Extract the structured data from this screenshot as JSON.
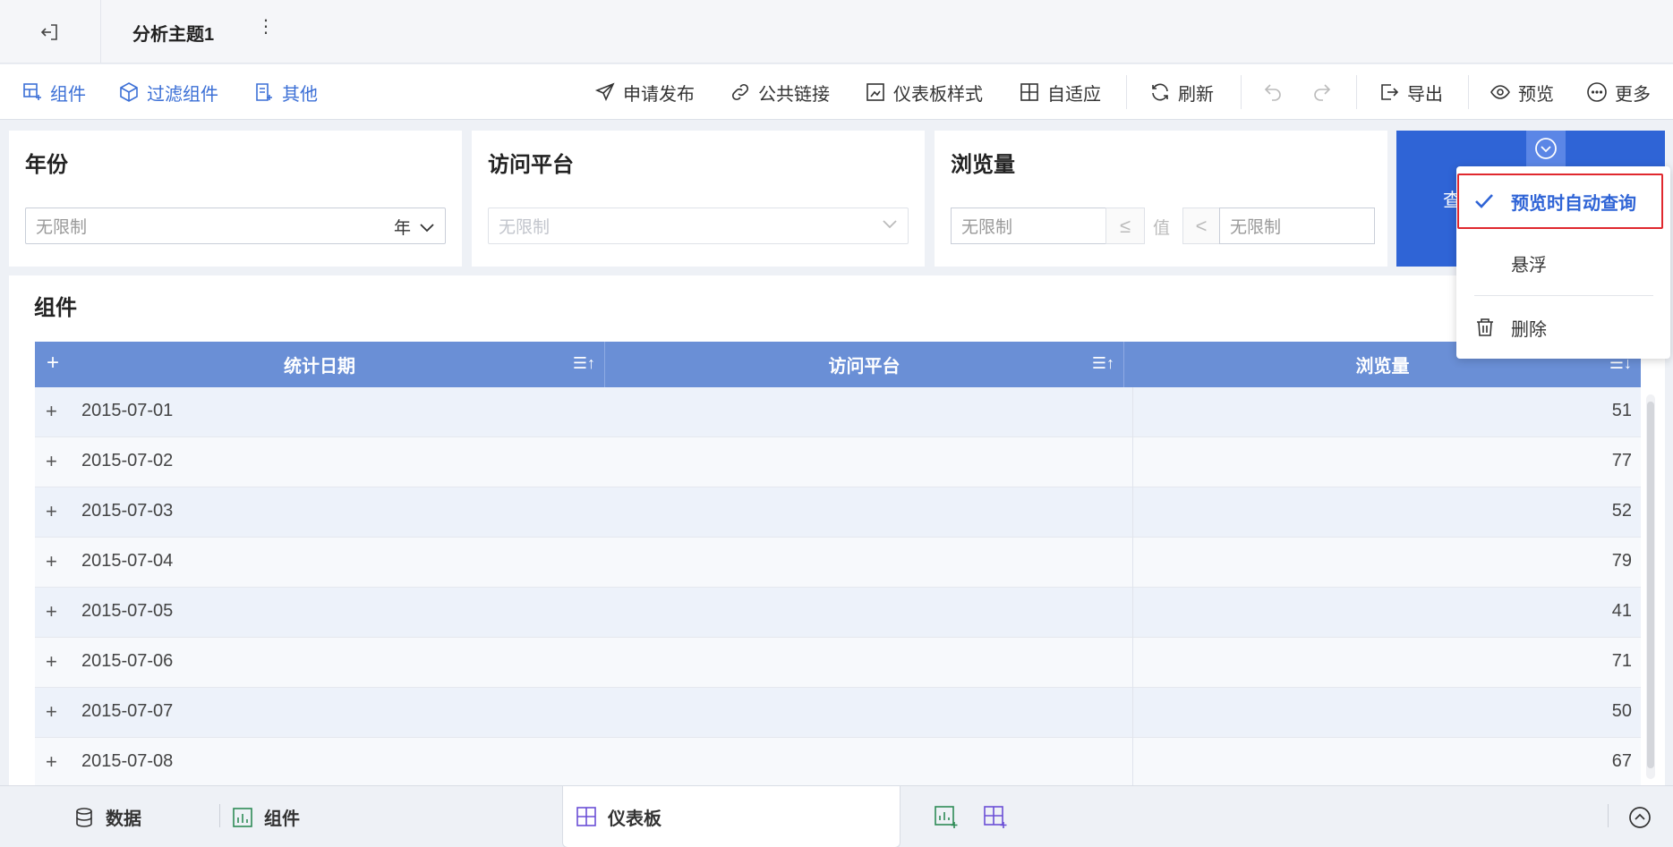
{
  "titlebar": {
    "title": "分析主题1",
    "more": "⋮"
  },
  "toolbar": {
    "left": [
      {
        "label": "组件",
        "icon": "add-widget-icon"
      },
      {
        "label": "过滤组件",
        "icon": "filter-widget-icon"
      },
      {
        "label": "其他",
        "icon": "other-widget-icon"
      }
    ],
    "right": {
      "publish": "申请发布",
      "public_link": "公共链接",
      "dashboard_style": "仪表板样式",
      "adaptive": "自适应",
      "refresh": "刷新",
      "export": "导出",
      "preview": "预览",
      "more": "更多"
    }
  },
  "filters": {
    "year": {
      "title": "年份",
      "placeholder": "无限制",
      "unit": "年"
    },
    "platform": {
      "title": "访问平台",
      "placeholder": "无限制"
    },
    "views": {
      "title": "浏览量",
      "min_placeholder": "无限制",
      "op_left": "≤",
      "value_label": "值",
      "op_right": "<",
      "max_placeholder": "无限制"
    }
  },
  "query_button": {
    "label": "查"
  },
  "dropdown_menu": {
    "items": [
      {
        "label": "预览时自动查询",
        "checked": true
      },
      {
        "label": "悬浮",
        "checked": false
      },
      {
        "label": "删除",
        "icon": "trash-icon"
      }
    ],
    "highlight_color": "#e0282e"
  },
  "component_panel": {
    "title": "组件",
    "columns": [
      "统计日期",
      "访问平台",
      "浏览量"
    ],
    "rows": [
      {
        "date": "2015-07-01",
        "platform": "",
        "views": "51"
      },
      {
        "date": "2015-07-02",
        "platform": "",
        "views": "77"
      },
      {
        "date": "2015-07-03",
        "platform": "",
        "views": "52"
      },
      {
        "date": "2015-07-04",
        "platform": "",
        "views": "79"
      },
      {
        "date": "2015-07-05",
        "platform": "",
        "views": "41"
      },
      {
        "date": "2015-07-06",
        "platform": "",
        "views": "71"
      },
      {
        "date": "2015-07-07",
        "platform": "",
        "views": "50"
      },
      {
        "date": "2015-07-08",
        "platform": "",
        "views": "67"
      }
    ]
  },
  "bottom_tabs": {
    "data": "数据",
    "component": "组件",
    "dashboard": "仪表板"
  },
  "colors": {
    "accent": "#2f64d6",
    "header": "#6a8fd6",
    "toolbar_link": "#3b6fd6"
  }
}
